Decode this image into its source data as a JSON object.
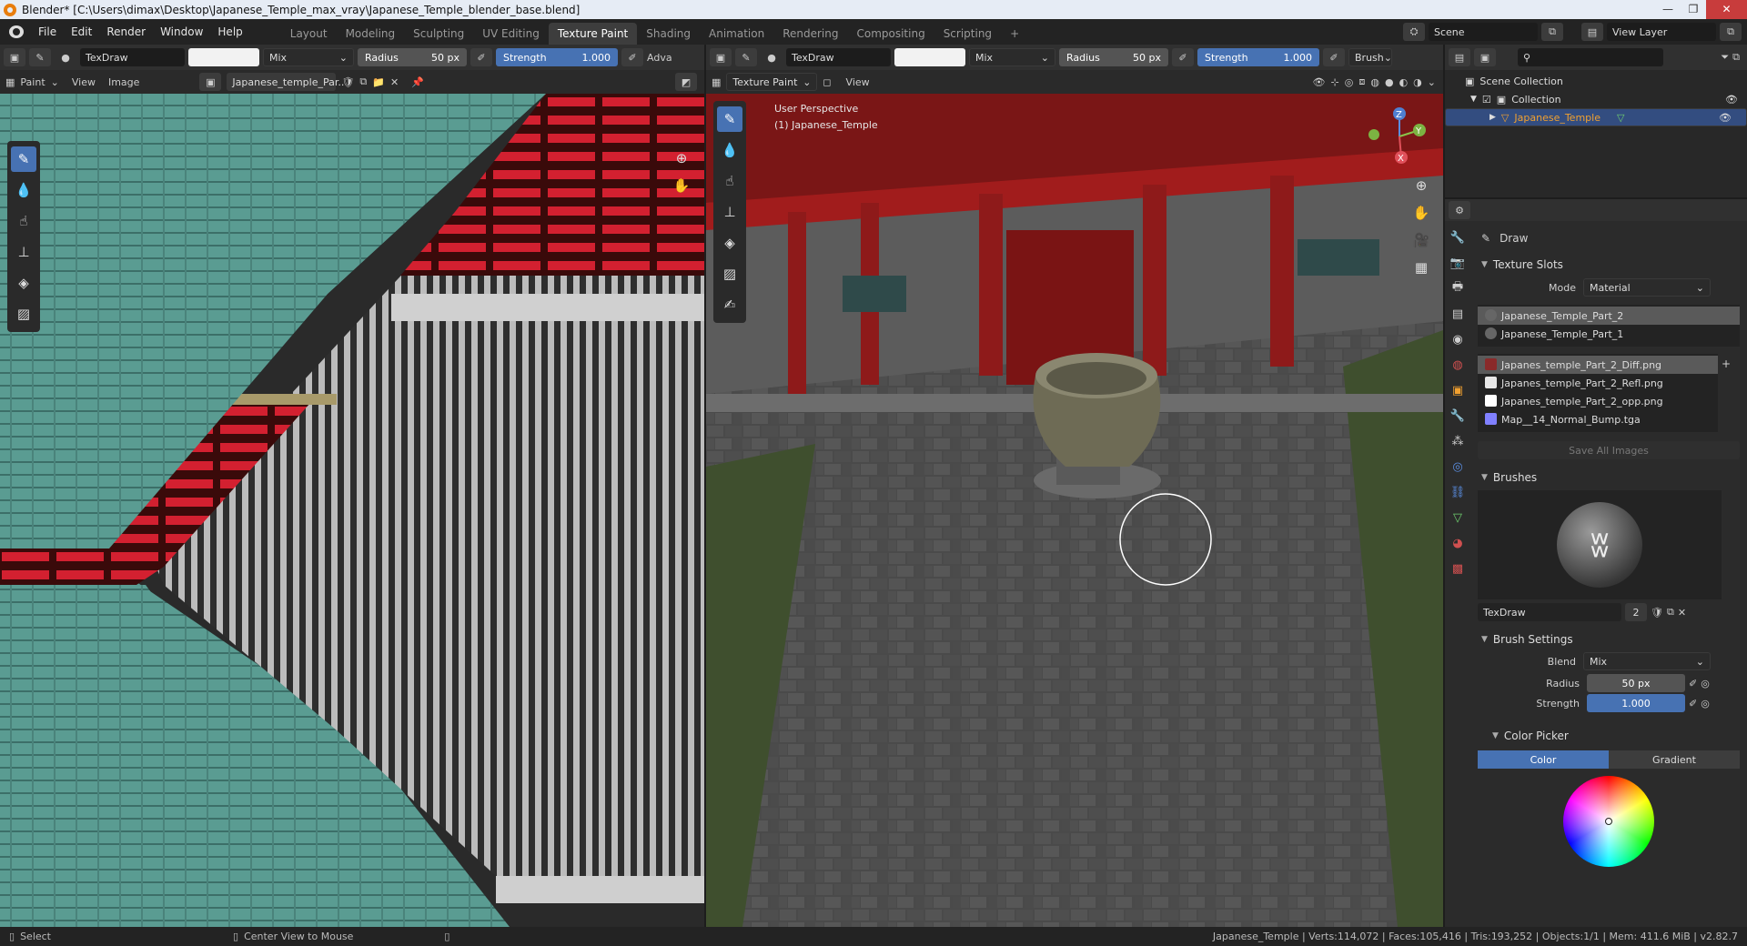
{
  "window": {
    "title": "Blender* [C:\\Users\\dimax\\Desktop\\Japanese_Temple_max_vray\\Japanese_Temple_blender_base.blend]"
  },
  "menu": {
    "items": [
      "File",
      "Edit",
      "Render",
      "Window",
      "Help"
    ]
  },
  "workspaces": {
    "tabs": [
      "Layout",
      "Modeling",
      "Sculpting",
      "UV Editing",
      "Texture Paint",
      "Shading",
      "Animation",
      "Rendering",
      "Compositing",
      "Scripting"
    ],
    "active": "Texture Paint",
    "add": "+"
  },
  "scene": {
    "label": "Scene",
    "view_layer": "View Layer"
  },
  "image_editor": {
    "brush_name": "TexDraw",
    "blend": "Mix",
    "radius_label": "Radius",
    "radius_value": "50 px",
    "strength_label": "Strength",
    "strength_value": "1.000",
    "adv": "Adva",
    "mode": "Paint",
    "view": "View",
    "image": "Image",
    "image_name": "Japanese_temple_Par.."
  },
  "viewport": {
    "brush_name": "TexDraw",
    "blend": "Mix",
    "radius_label": "Radius",
    "radius_value": "50 px",
    "strength_label": "Strength",
    "strength_value": "1.000",
    "brush_menu": "Brush",
    "mode": "Texture Paint",
    "view": "View",
    "overlay_line1": "User Perspective",
    "overlay_line2": "(1) Japanese_Temple",
    "gizmo": {
      "z": "Z",
      "y": "Y",
      "x": "X"
    }
  },
  "outliner": {
    "scene_collection": "Scene Collection",
    "collection": "Collection",
    "object": "Japanese_Temple"
  },
  "properties": {
    "tool_name": "Draw",
    "texture_slots": {
      "title": "Texture Slots",
      "mode_label": "Mode",
      "mode_value": "Material",
      "materials": [
        "Japanese_Temple_Part_2",
        "Japanese_Temple_Part_1"
      ],
      "images": [
        {
          "name": "Japanes_temple_Part_2_Diff.png",
          "color": "#8a2a2a"
        },
        {
          "name": "Japanes_temple_Part_2_Refl.png",
          "color": "#e8e8e8"
        },
        {
          "name": "Japanes_temple_Part_2_opp.png",
          "color": "#ffffff"
        },
        {
          "name": "Map__14_Normal_Bump.tga",
          "color": "#8080ff"
        }
      ],
      "save_all": "Save All Images"
    },
    "brushes": {
      "title": "Brushes",
      "brush_name": "TexDraw",
      "users": "2"
    },
    "brush_settings": {
      "title": "Brush Settings",
      "blend_label": "Blend",
      "blend_value": "Mix",
      "radius_label": "Radius",
      "radius_value": "50 px",
      "strength_label": "Strength",
      "strength_value": "1.000"
    },
    "color_picker": {
      "title": "Color Picker",
      "tab_color": "Color",
      "tab_gradient": "Gradient"
    }
  },
  "status": {
    "select": "Select",
    "center": "Center View to Mouse",
    "stats": "Japanese_Temple | Verts:114,072 | Faces:105,416 | Tris:193,252 | Objects:1/1 | Mem: 411.6 MiB | v2.82.7"
  },
  "colors": {
    "accent": "#4772b3",
    "selection": "#334d80",
    "object_text": "#f0a030",
    "brush": "#ffffff"
  }
}
